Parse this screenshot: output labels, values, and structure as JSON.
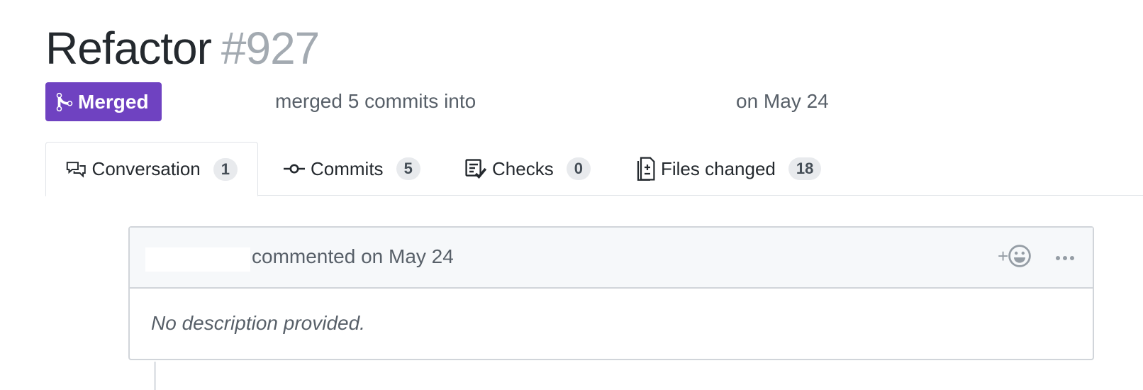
{
  "pr": {
    "title": "Refactor",
    "number": "#927",
    "state_label": "Merged",
    "merge_text": "merged 5 commits into",
    "merge_date": "on May 24"
  },
  "tabs": [
    {
      "label": "Conversation",
      "count": "1",
      "icon": "comment-discussion-icon",
      "active": true
    },
    {
      "label": "Commits",
      "count": "5",
      "icon": "git-commit-icon",
      "active": false
    },
    {
      "label": "Checks",
      "count": "0",
      "icon": "checklist-icon",
      "active": false
    },
    {
      "label": "Files changed",
      "count": "18",
      "icon": "file-diff-icon",
      "active": false
    }
  ],
  "comment": {
    "action_text": "commented on May 24",
    "body": "No description provided.",
    "reaction_label": "+"
  },
  "colors": {
    "merged_purple": "#6f42c1",
    "muted_text": "#586069",
    "border": "#d1d5da",
    "header_bg": "#f6f8fa"
  }
}
